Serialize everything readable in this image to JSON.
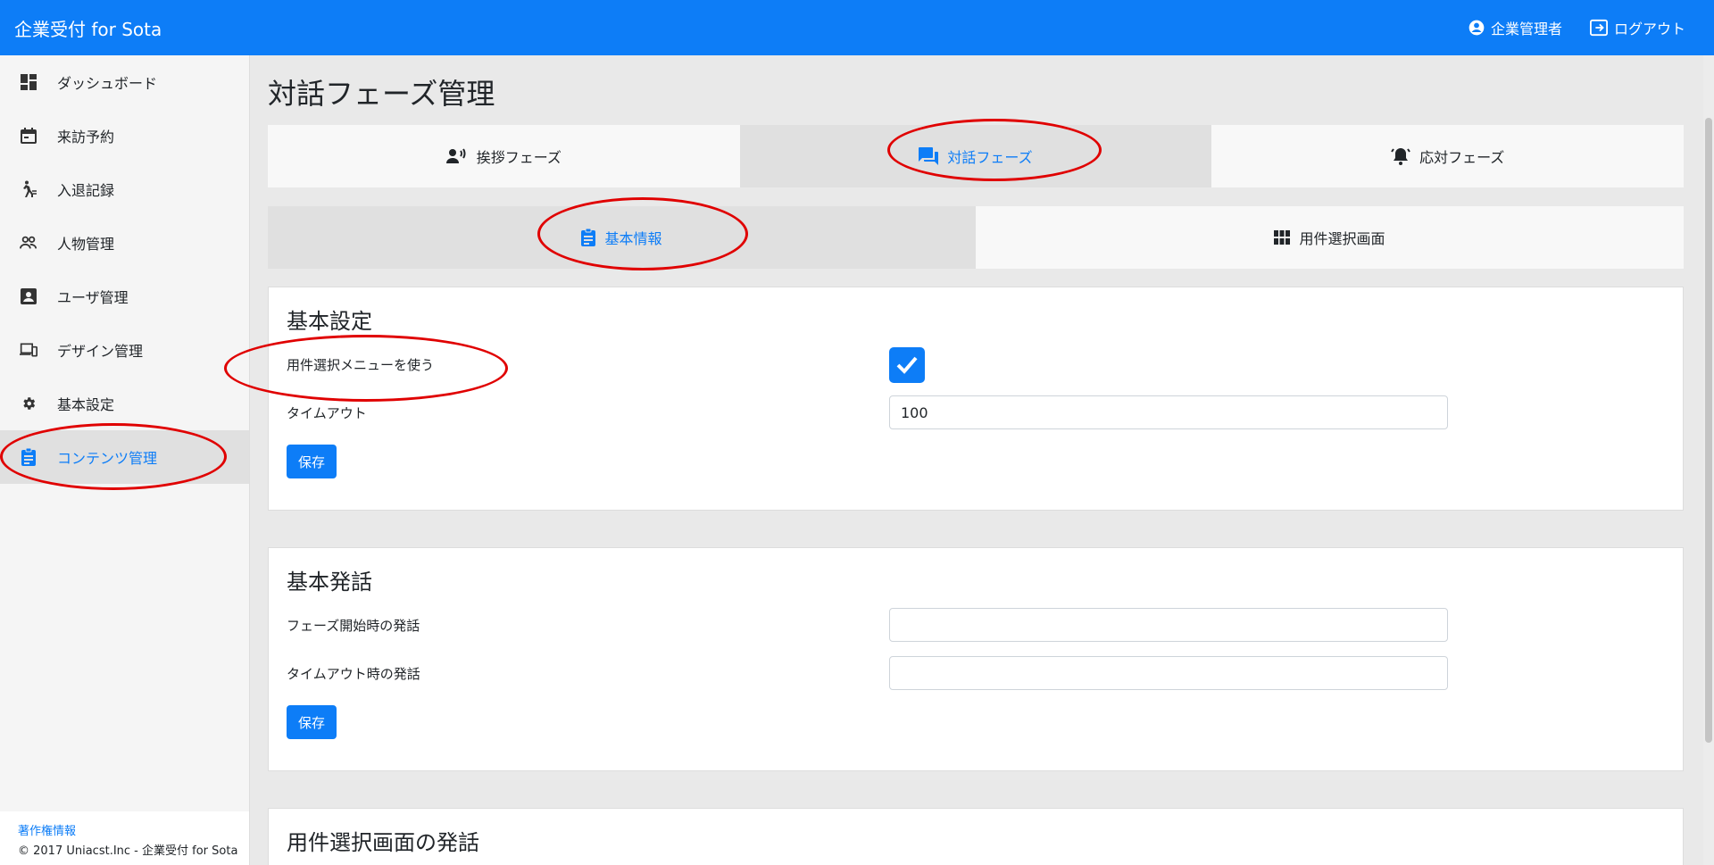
{
  "header": {
    "brand": "企業受付 for Sota",
    "user": "企業管理者",
    "logout": "ログアウト"
  },
  "sidebar": {
    "items": [
      {
        "label": "ダッシュボード",
        "icon": "dashboard-icon"
      },
      {
        "label": "来訪予約",
        "icon": "calendar-icon"
      },
      {
        "label": "入退記録",
        "icon": "walk-icon"
      },
      {
        "label": "人物管理",
        "icon": "people-icon"
      },
      {
        "label": "ユーザ管理",
        "icon": "user-card-icon"
      },
      {
        "label": "デザイン管理",
        "icon": "devices-icon"
      },
      {
        "label": "基本設定",
        "icon": "gear-icon"
      },
      {
        "label": "コンテンツ管理",
        "icon": "clipboard-icon",
        "active": true
      }
    ],
    "footer": {
      "copyright_link": "著作権情報",
      "copyright_text": "© 2017 Uniacst.Inc - 企業受付 for Sota"
    }
  },
  "main": {
    "title": "対話フェーズ管理",
    "phase_tabs": [
      {
        "label": "挨拶フェーズ",
        "icon": "speaker-person-icon"
      },
      {
        "label": "対話フェーズ",
        "icon": "chat-icon",
        "active": true
      },
      {
        "label": "応対フェーズ",
        "icon": "bell-icon"
      }
    ],
    "sub_tabs": [
      {
        "label": "基本情報",
        "icon": "clipboard-icon",
        "active": true
      },
      {
        "label": "用件選択画面",
        "icon": "grid-icon"
      }
    ],
    "basic_settings": {
      "heading": "基本設定",
      "use_menu_label": "用件選択メニューを使う",
      "use_menu_checked": true,
      "timeout_label": "タイムアウト",
      "timeout_value": "100",
      "save_label": "保存"
    },
    "basic_speech": {
      "heading": "基本発話",
      "start_label": "フェーズ開始時の発話",
      "start_value": "",
      "timeout_label": "タイムアウト時の発話",
      "timeout_value": "",
      "save_label": "保存"
    },
    "menu_speech": {
      "heading": "用件選択画面の発話"
    }
  },
  "colors": {
    "primary": "#0d7df7",
    "annotation": "#e00000"
  }
}
